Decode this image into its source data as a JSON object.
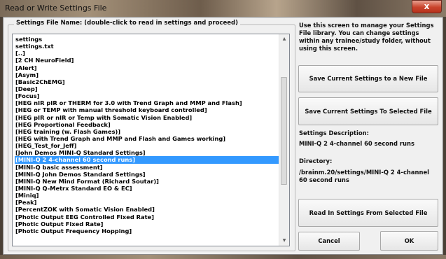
{
  "window": {
    "title": "Read or Write Settings File",
    "close_glyph": "x"
  },
  "files_group": {
    "label": "Settings File Name: (double-click to read in settings and proceed)",
    "selected_index": 21,
    "items": [
      "settings",
      "settings.txt",
      "[..]",
      "[2 CH NeuroField]",
      "[Alert]",
      "[Asym]",
      "[Basic2ChEMG]",
      "[Deep]",
      "[Focus]",
      "[HEG nIR pIR or THERM for 3.0 with Trend Graph and MMP and Flash]",
      "[HEG or TEMP with manual threshold keyboard controlled]",
      "[HEG pIR or nIR or Temp with Somatic Vision Enabled]",
      "[HEG Proportional Feedback]",
      "[HEG training (w. Flash Games)]",
      "[HEG with Trend Graph and MMP and Flash and Games working]",
      "[HEG_Test_for_Jeff]",
      "[John Demos MINI-Q Standard Settings]",
      "[MINI-Q 2 4-channel 60 second runs]",
      "[MINI-Q basic assessment]",
      "[MINI-Q John Demos Standard Settings]",
      "[MINI-Q New Mind Format (Richard Soutar)]",
      "[MINI-Q Q-Metrx Standard EO & EC]",
      "[Miniq]",
      "[Peak]",
      "[PercentZOK with Somatic Vision Enabled]",
      "[Photic Output EEG Controlled Fixed Rate]",
      "[Photic Output Fixed Rate]",
      "[Photic Output Frequency Hopping]"
    ]
  },
  "info_text": "Use this screen to manage your Settings File library.  You can change settings within any trainee/study folder, without using this screen.",
  "buttons": {
    "save_new": "Save Current Settings to a New File",
    "save_selected": "Save Current Settings To Selected File",
    "read_selected": "Read In Settings From Selected File",
    "cancel": "Cancel",
    "ok": "OK"
  },
  "description": {
    "label": "Settings Description:",
    "value": "MINI-Q 2 4-channel 60 second runs"
  },
  "directory": {
    "label": "Directory:",
    "value": "/brainm.20/settings/MINI-Q 2 4-channel 60 second runs"
  },
  "scrollbar": {
    "up_glyph": "▲",
    "down_glyph": "▼",
    "grip_glyph": "≡"
  }
}
